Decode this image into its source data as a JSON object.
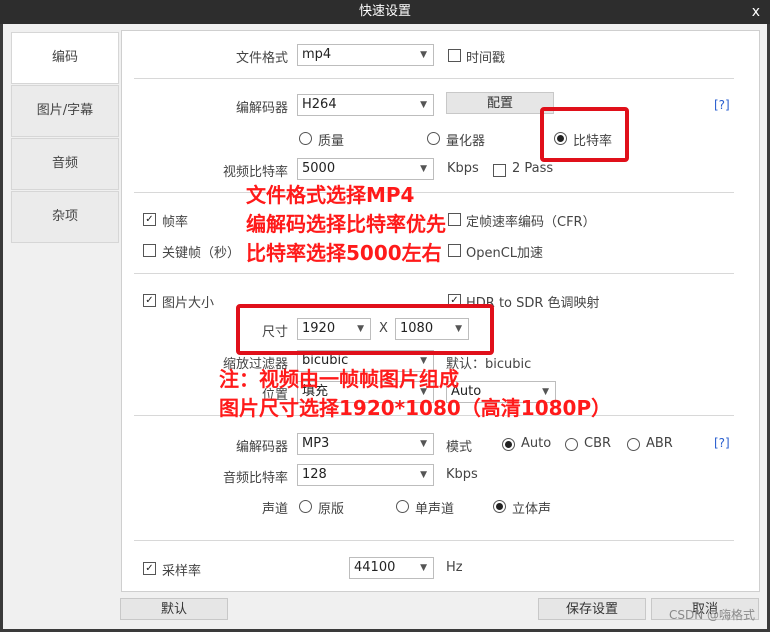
{
  "window": {
    "title": "快速设置",
    "close": "x"
  },
  "sidebar": {
    "items": [
      {
        "label": "编码"
      },
      {
        "label": "图片/字幕"
      },
      {
        "label": "音频"
      },
      {
        "label": "杂项"
      }
    ]
  },
  "video": {
    "format_label": "文件格式",
    "format_value": "mp4",
    "timestamp_label": "时间戳",
    "codec_label": "编解码器",
    "codec_value": "H264",
    "config_button": "配置",
    "help": "[?]",
    "mode_quality": "质量",
    "mode_quantizer": "量化器",
    "mode_bitrate": "比特率",
    "bitrate_label": "视频比特率",
    "bitrate_value": "5000",
    "bitrate_unit": "Kbps",
    "twopass_label": "2 Pass",
    "framerate_label": "帧率",
    "cfr_label": "定帧速率编码（CFR）",
    "keyframe_label": "关键帧（秒）",
    "opencl_label": "OpenCL加速"
  },
  "picture": {
    "size_label": "图片大小",
    "hdr_label": "HDR to SDR 色调映射",
    "dim_label": "尺寸",
    "width": "1920",
    "x": "X",
    "height": "1080",
    "filter_label": "缩放过滤器",
    "filter_value": "bicubic",
    "default_label": "默认：bicubic",
    "position_label": "位置",
    "position_value": "填充",
    "auto_value": "Auto"
  },
  "audio": {
    "codec_label": "编解码器",
    "codec_value": "MP3",
    "mode_label": "模式",
    "auto": "Auto",
    "cbr": "CBR",
    "abr": "ABR",
    "help": "[?]",
    "bitrate_label": "音频比特率",
    "bitrate_value": "128",
    "bitrate_unit": "Kbps",
    "channel_label": "声道",
    "ch_original": "原版",
    "ch_mono": "单声道",
    "ch_stereo": "立体声",
    "samplerate_label": "采样率",
    "samplerate_value": "44100",
    "samplerate_unit": "Hz"
  },
  "footer": {
    "default_button": "默认",
    "save_button": "保存设置",
    "cancel_button": "取消"
  },
  "annotations": {
    "line1": "文件格式选择MP4",
    "line2": "编解码选择比特率优先",
    "line3": "比特率选择5000左右",
    "line4": "注：视频由一帧帧图片组成",
    "line5": "图片尺寸选择1920*1080（高清1080P）",
    "color": "#ff1a1a"
  },
  "watermark": "CSDN @嗨格式"
}
